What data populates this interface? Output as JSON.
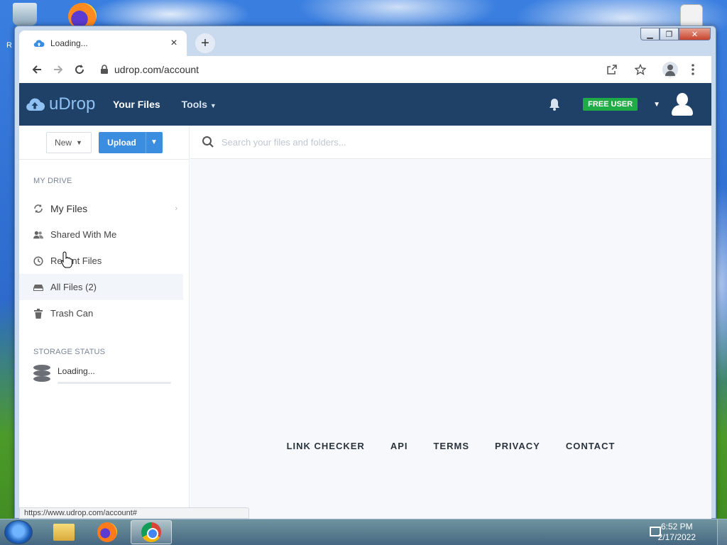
{
  "browser": {
    "tab_title": "Loading...",
    "tab_close": "×",
    "new_tab": "+",
    "url": "udrop.com/account",
    "status_url": "https://www.udrop.com/account#"
  },
  "site": {
    "brand": "uDrop",
    "nav_your_files": "Your Files",
    "nav_tools": "Tools",
    "badge": "FREE USER",
    "colors": {
      "header": "#1f4168",
      "badge": "#1fab45",
      "upload": "#3b8de0",
      "brand": "#8fc2f2"
    }
  },
  "sidebar": {
    "new_label": "New",
    "upload_label": "Upload",
    "my_drive_heading": "MY DRIVE",
    "items": [
      {
        "label": "My Files",
        "icon": "refresh-icon"
      },
      {
        "label": "Shared With Me",
        "icon": "users-icon"
      },
      {
        "label": "Recent Files",
        "icon": "clock-icon"
      },
      {
        "label": "All Files (2)",
        "icon": "drive-icon"
      },
      {
        "label": "Trash Can",
        "icon": "trash-icon"
      }
    ],
    "storage_heading": "STORAGE STATUS",
    "storage_text": "Loading..."
  },
  "main": {
    "search_placeholder": "Search your files and folders...",
    "footer_links": [
      "LINK CHECKER",
      "API",
      "TERMS",
      "PRIVACY",
      "CONTACT"
    ]
  },
  "taskbar": {
    "time": "6:52 PM",
    "date": "2/17/2022"
  },
  "desktop": {
    "partial_label": "R"
  }
}
